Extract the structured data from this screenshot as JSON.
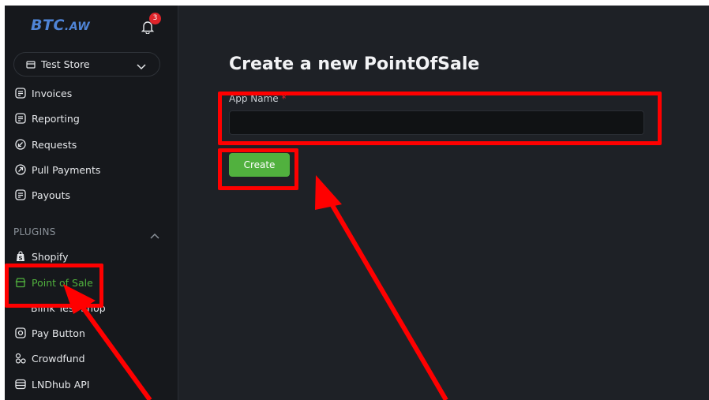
{
  "brand": {
    "logo_main": "BTC",
    "logo_suffix": ".AW"
  },
  "notifications": {
    "count": "3"
  },
  "store_selector": {
    "label": "Test Store"
  },
  "nav_main": [
    {
      "label": "Invoices",
      "icon": "invoice-icon"
    },
    {
      "label": "Reporting",
      "icon": "reporting-icon"
    },
    {
      "label": "Requests",
      "icon": "requests-icon"
    },
    {
      "label": "Pull Payments",
      "icon": "pull-payments-icon"
    },
    {
      "label": "Payouts",
      "icon": "payouts-icon"
    }
  ],
  "plugins": {
    "label": "PLUGINS",
    "items": [
      {
        "label": "Shopify",
        "icon": "shopify-icon"
      },
      {
        "label": "Point of Sale",
        "icon": "point-of-sale-icon",
        "active": true
      },
      {
        "label": "Blink Test Shop",
        "icon": ""
      },
      {
        "label": "Pay Button",
        "icon": "pay-button-icon"
      },
      {
        "label": "Crowdfund",
        "icon": "crowdfund-icon"
      },
      {
        "label": "LNDhub API",
        "icon": "lndhub-icon"
      }
    ]
  },
  "main": {
    "title": "Create a new PointOfSale",
    "app_name_label": "App Name",
    "required_marker": "*",
    "app_name_value": "",
    "create_button": "Create"
  },
  "colors": {
    "accent": "#51b13e",
    "highlight": "#ff0000",
    "logo": "#4f84d6",
    "badge": "#e0242a"
  }
}
